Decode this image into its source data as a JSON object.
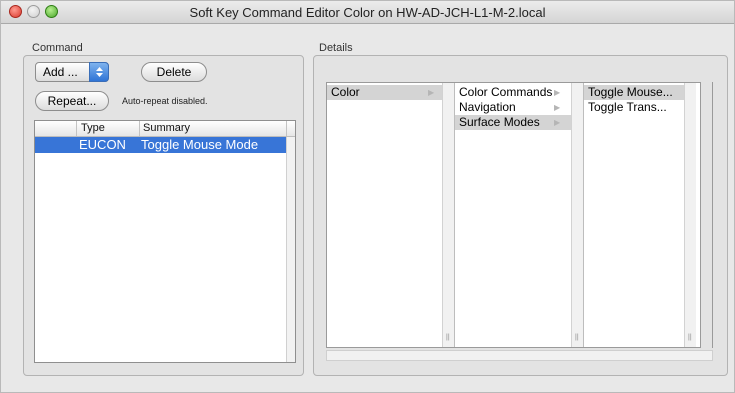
{
  "window": {
    "title": "Soft Key Command Editor Color on  HW-AD-JCH-L1-M-2.local"
  },
  "command": {
    "section_label": "Command",
    "add_popup_label": "Add ...",
    "delete_label": "Delete",
    "repeat_label": "Repeat...",
    "auto_repeat_note": "Auto-repeat disabled.",
    "columns": [
      "Type",
      "Summary"
    ],
    "rows": [
      {
        "type": "EUCON",
        "summary": "Toggle Mouse Mode"
      }
    ]
  },
  "details": {
    "section_label": "Details",
    "columns": [
      {
        "items": [
          {
            "label": "Color",
            "selected": true
          }
        ]
      },
      {
        "items": [
          {
            "label": "Color Commands",
            "selected": false
          },
          {
            "label": "Navigation",
            "selected": false
          },
          {
            "label": "Surface Modes",
            "selected": true
          }
        ]
      },
      {
        "items": [
          {
            "label": "Toggle Mouse...",
            "selected": true
          },
          {
            "label": "Toggle Trans...",
            "selected": false
          }
        ]
      }
    ]
  },
  "colors": {
    "selection_blue": "#3875d7",
    "browser_selection_gray": "#d4d4d4",
    "close_red": "#d9382c",
    "zoom_green": "#4aa72a"
  }
}
